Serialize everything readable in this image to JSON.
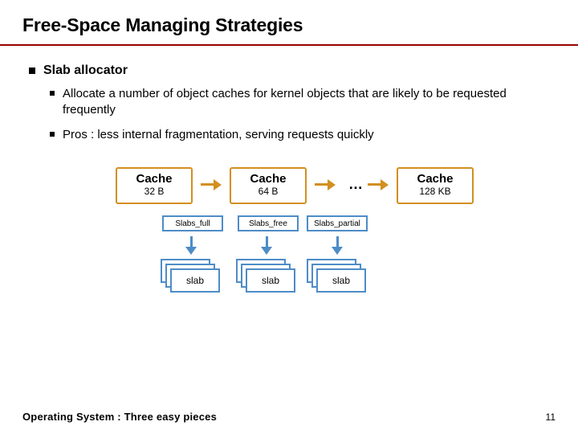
{
  "title": "Free-Space Managing Strategies",
  "heading": "Slab allocator",
  "bullets": {
    "b1": "Allocate a number of object caches for kernel objects that are likely to be requested frequently",
    "b2": "Pros : less internal fragmentation, serving requests quickly"
  },
  "diagram": {
    "cache_label": "Cache",
    "cache_sizes": {
      "c1": "32 B",
      "c2": "64 B",
      "c3": "128 KB"
    },
    "ellipsis": "…",
    "slab_states": {
      "full": "Slabs_full",
      "free": "Slabs_free",
      "partial": "Slabs_partial"
    },
    "slab_label": "slab"
  },
  "footer": {
    "text": "Operating System : Three easy pieces",
    "page": "11"
  }
}
